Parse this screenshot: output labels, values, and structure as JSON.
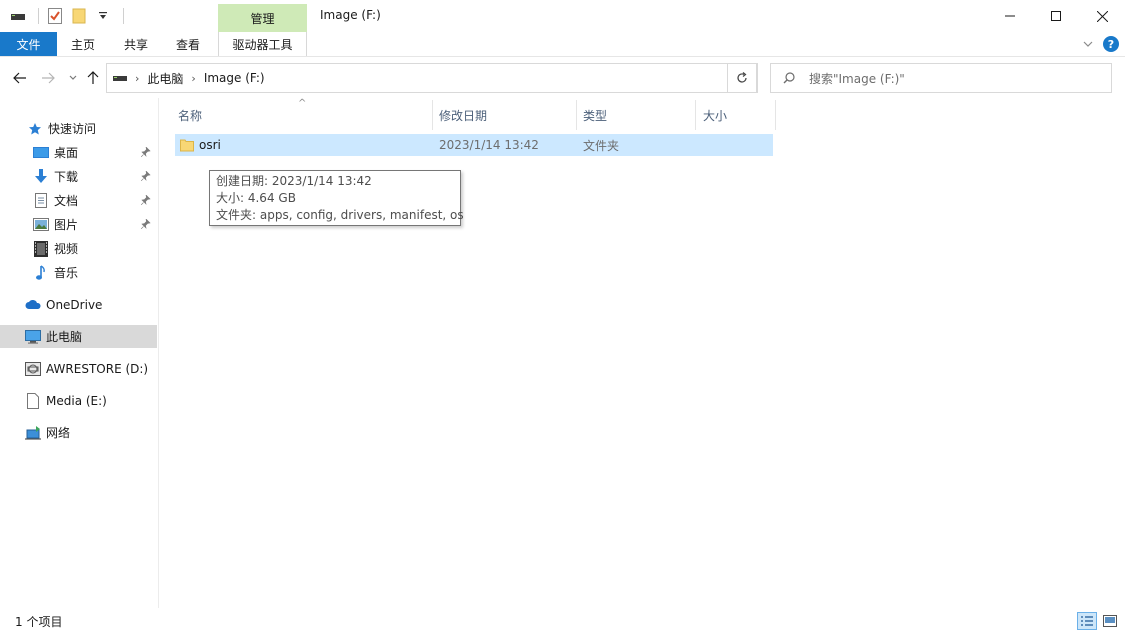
{
  "titlebar": {
    "manage_label": "管理",
    "window_title": "Image (F:)"
  },
  "ribbon": {
    "tabs": [
      {
        "label": "文件"
      },
      {
        "label": "主页"
      },
      {
        "label": "共享"
      },
      {
        "label": "查看"
      },
      {
        "label": "驱动器工具"
      }
    ]
  },
  "address": {
    "crumbs": [
      "此电脑",
      "Image (F:)"
    ]
  },
  "search": {
    "placeholder": "搜索\"Image (F:)\""
  },
  "nav": {
    "quick_access": "快速访问",
    "items": [
      {
        "label": "桌面",
        "icon": "desktop-icon"
      },
      {
        "label": "下载",
        "icon": "download-icon"
      },
      {
        "label": "文档",
        "icon": "document-icon"
      },
      {
        "label": "图片",
        "icon": "picture-icon"
      },
      {
        "label": "视频",
        "icon": "video-icon"
      },
      {
        "label": "音乐",
        "icon": "music-icon"
      }
    ],
    "onedrive": "OneDrive",
    "this_pc": "此电脑",
    "drive_d": "AWRESTORE (D:)",
    "drive_e": "Media (E:)",
    "network": "网络"
  },
  "columns": {
    "name": "名称",
    "date": "修改日期",
    "type": "类型",
    "size": "大小"
  },
  "files": [
    {
      "name": "osri",
      "date": "2023/1/14 13:42",
      "type": "文件夹",
      "size": ""
    }
  ],
  "tooltip": {
    "created": "创建日期: 2023/1/14 13:42",
    "size": "大小: 4.64 GB",
    "folders": "文件夹: apps, config, drivers, manifest, os"
  },
  "status": {
    "count": "1 个项目"
  },
  "colors": {
    "accent": "#1979ca",
    "manage_tab": "#cfeab7",
    "selection": "#cce8ff",
    "folder": "#f8d775"
  }
}
